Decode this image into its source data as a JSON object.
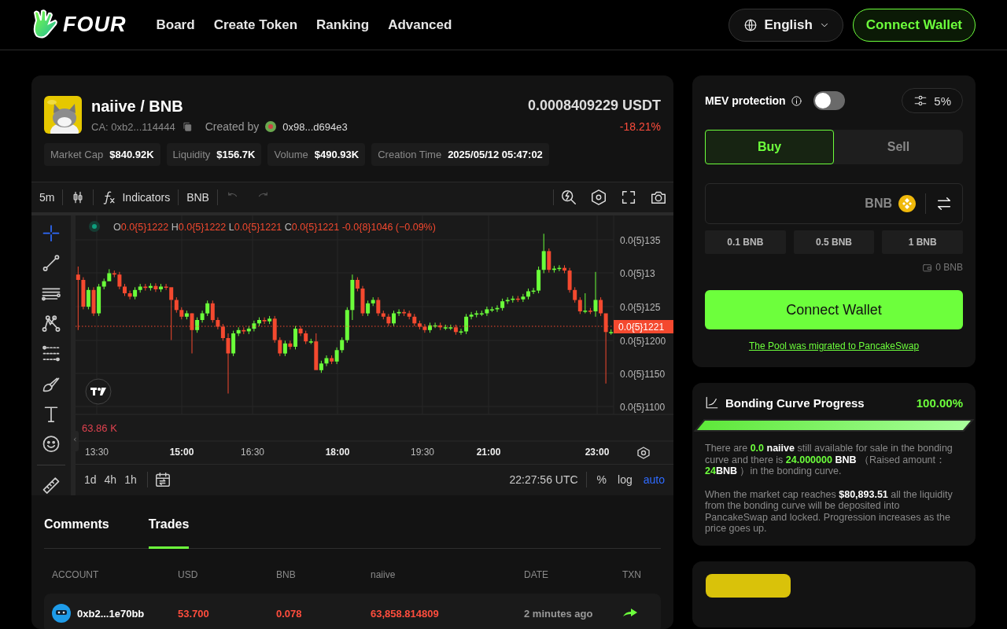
{
  "header": {
    "logo_text": "FOUR",
    "nav": [
      "Board",
      "Create Token",
      "Ranking",
      "Advanced"
    ],
    "language": "English",
    "connect": "Connect Wallet"
  },
  "token": {
    "pair": "naiive / BNB",
    "ca": "CA: 0xb2...114444",
    "created_label": "Created by",
    "creator": "0x98...d694e3",
    "price": "0.0008409229 USDT",
    "change": "-18.21%",
    "stats": [
      {
        "label": "Market Cap",
        "value": "$840.92K"
      },
      {
        "label": "Liquidity",
        "value": "$156.7K"
      },
      {
        "label": "Volume",
        "value": "$490.93K"
      },
      {
        "label": "Creation Time",
        "value": "2025/05/12 05:47:02"
      }
    ]
  },
  "chart": {
    "interval": "5m",
    "indicators": "Indicators",
    "symbol": "BNB",
    "tools": [
      {
        "selected": true
      },
      {
        "selected": false
      },
      {
        "selected": false
      },
      {
        "selected": false
      },
      {
        "selected": false
      },
      {
        "selected": false
      },
      {
        "selected": false
      },
      {
        "selected": false
      },
      {
        "selected": false
      }
    ],
    "legend": [
      {
        "key": "O",
        "value": "0.0{5}1222"
      },
      {
        "key": "H",
        "value": "0.0{5}1222"
      },
      {
        "key": "L",
        "value": "0.0{5}1221"
      },
      {
        "key": "C",
        "value": "0.0{5}1221"
      }
    ],
    "legend_change": "-0.0{8}1046 (−0.09%)",
    "price_ticks": [
      "0.0{5}135",
      "0.0{5}13",
      "0.0{5}125",
      "0.0{5}1200",
      "0.0{5}1150",
      "0.0{5}1100"
    ],
    "last_price": "0.0{5}1221",
    "volume": "63.86 K",
    "time_ticks": [
      {
        "label": "13:30",
        "major": false
      },
      {
        "label": "15:00",
        "major": true
      },
      {
        "label": "16:30",
        "major": false
      },
      {
        "label": "18:00",
        "major": true
      },
      {
        "label": "19:30",
        "major": false
      },
      {
        "label": "21:00",
        "major": true
      },
      {
        "label": "23:00",
        "major": true
      }
    ],
    "ranges": [
      "1d",
      "4h",
      "1h"
    ],
    "clock": "22:27:56 UTC",
    "scales": [
      {
        "label": "%",
        "selected": false
      },
      {
        "label": "log",
        "selected": false
      },
      {
        "label": "auto",
        "selected": true
      }
    ]
  },
  "activity": {
    "tabs": [
      {
        "label": "Comments",
        "selected": false
      },
      {
        "label": "Trades",
        "selected": true
      }
    ],
    "columns": [
      "ACCOUNT",
      "USD",
      "BNB",
      "naiive",
      "DATE",
      "TXN"
    ],
    "rows": [
      {
        "account": "0xb2...1e70bb",
        "usd": "53.700",
        "bnb": "0.078",
        "amount": "63,858.814809",
        "date": "2 minutes ago",
        "kind": "sell"
      }
    ]
  },
  "trade": {
    "mev_label": "MEV protection",
    "mev_on": false,
    "slippage": "5%",
    "sides": [
      {
        "label": "Buy",
        "selected": true
      },
      {
        "label": "Sell",
        "selected": false
      }
    ],
    "currency": "BNB",
    "presets": [
      "0.1 BNB",
      "0.5 BNB",
      "1 BNB"
    ],
    "balance": "0 BNB",
    "connect": "Connect Wallet",
    "notice": "The Pool was migrated to PancakeSwap"
  },
  "bonding": {
    "title": "Bonding Curve Progress",
    "percent": "100.00%",
    "level": 1.0,
    "paragraphs": [
      [
        {
          "kind": "plain",
          "text": "There are "
        },
        {
          "kind": "accent",
          "text": "0.0 "
        },
        {
          "kind": "strong",
          "text": "naiive"
        },
        {
          "kind": "plain",
          "text": " still available for sale in the bonding curve and there is "
        },
        {
          "kind": "accent",
          "text": "24.000000 "
        },
        {
          "kind": "strong",
          "text": "BNB"
        },
        {
          "kind": "plain",
          "text": " （Raised amount： "
        },
        {
          "kind": "accent",
          "text": "24"
        },
        {
          "kind": "strong",
          "text": "BNB"
        },
        {
          "kind": "plain",
          "text": " ）in the bonding curve."
        }
      ],
      [
        {
          "kind": "plain",
          "text": "When the market cap reaches "
        },
        {
          "kind": "strong",
          "text": "$80,893.51"
        },
        {
          "kind": "plain",
          "text": " all the liquidity from the bonding curve will be deposited into PancakeSwap and locked. Progression increases as the price goes up."
        }
      ]
    ]
  }
}
